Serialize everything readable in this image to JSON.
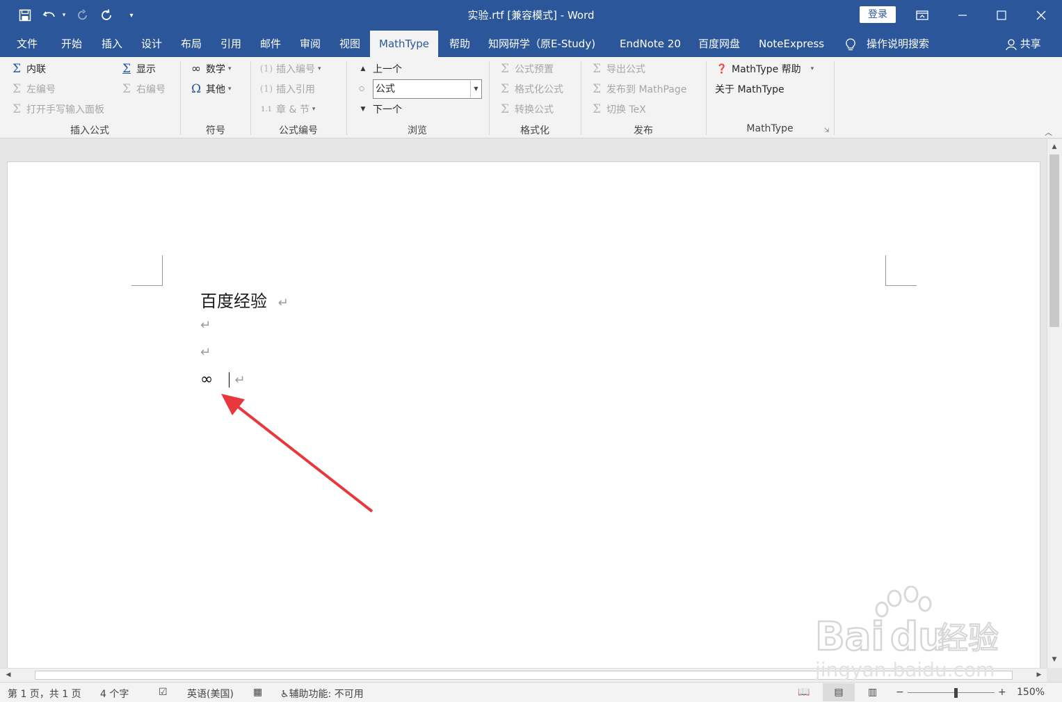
{
  "titlebar": {
    "title": "实验.rtf [兼容模式]  -  Word",
    "login": "登录",
    "quick_access": [
      "save-icon",
      "undo-icon",
      "redo-icon",
      "refresh-icon",
      "customize-icon"
    ],
    "window_controls": [
      "ribbon-display-icon",
      "minimize-icon",
      "maximize-icon",
      "close-icon"
    ]
  },
  "tabs": [
    {
      "label": "文件"
    },
    {
      "label": "开始"
    },
    {
      "label": "插入"
    },
    {
      "label": "设计"
    },
    {
      "label": "布局"
    },
    {
      "label": "引用"
    },
    {
      "label": "邮件"
    },
    {
      "label": "审阅"
    },
    {
      "label": "视图"
    },
    {
      "label": "MathType",
      "active": true
    },
    {
      "label": "帮助"
    },
    {
      "label": "知网研学（原E-Study)"
    },
    {
      "label": "EndNote 20"
    },
    {
      "label": "百度网盘"
    },
    {
      "label": "NoteExpress"
    }
  ],
  "tell_me": "操作说明搜索",
  "share": "共享",
  "ribbon": {
    "insert_equation": {
      "title": "插入公式",
      "inline": "内联",
      "display": "显示",
      "left_number": "左编号",
      "right_number": "右编号",
      "handwriting": "打开手写输入面板"
    },
    "symbols": {
      "title": "符号",
      "math": "数学",
      "other": "其他"
    },
    "equation_numbers": {
      "title": "公式编号",
      "insert_number": "插入编号",
      "insert_reference": "插入引用",
      "chapter_section": "章 & 节"
    },
    "browse": {
      "title": "浏览",
      "previous": "上一个",
      "next": "下一个",
      "combo_value": "公式"
    },
    "format": {
      "title": "格式化",
      "presets": "公式预置",
      "format_equations": "格式化公式",
      "convert": "转换公式"
    },
    "publish": {
      "title": "发布",
      "export": "导出公式",
      "mathpage": "发布到 MathPage",
      "toggle_tex": "切换 TeX"
    },
    "mathtype": {
      "title": "MathType",
      "help": "MathType 帮助",
      "about": "关于 MathType"
    }
  },
  "document": {
    "heading": "百度经验",
    "paragraph_mark": "↵",
    "symbol": "∞",
    "arrow_color": "#e8383d"
  },
  "status": {
    "page": "第 1 页，共 1 页",
    "words": "4 个字",
    "language": "英语(美国)",
    "accessibility": "辅助功能: 不可用",
    "zoom": "150%"
  },
  "watermark": {
    "brand": "Bai",
    "brand2": "du",
    "cn": "经验",
    "url": "jingyan.baidu.com"
  },
  "colors": {
    "word_blue": "#2b579a",
    "ribbon_bg": "#f3f3f3"
  }
}
